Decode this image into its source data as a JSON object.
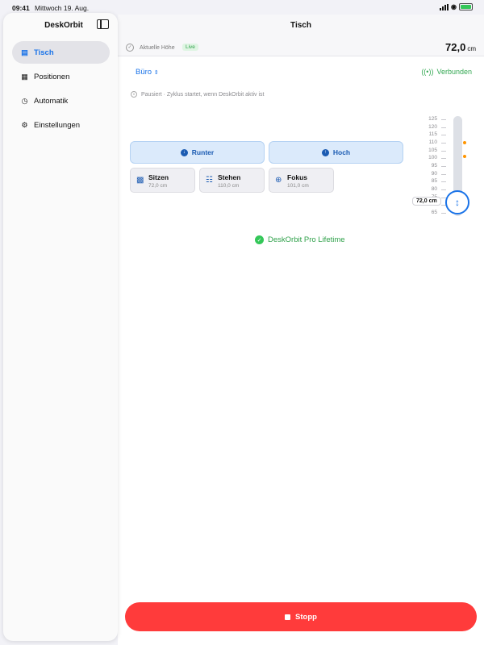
{
  "status": {
    "time": "09:41",
    "date": "Mittwoch 19. Aug."
  },
  "sidebar": {
    "title": "DeskOrbit",
    "items": [
      {
        "label": "Tisch",
        "icon": "desk-icon",
        "active": true
      },
      {
        "label": "Positionen",
        "icon": "grid-icon",
        "active": false
      },
      {
        "label": "Automatik",
        "icon": "clock-icon",
        "active": false
      },
      {
        "label": "Einstellungen",
        "icon": "gear-icon",
        "active": false
      }
    ]
  },
  "header": {
    "title": "Tisch",
    "height_label": "Aktuelle Höhe",
    "live_badge": "Live",
    "height_value": "72,0",
    "height_unit": "cm"
  },
  "room": {
    "selected": "Büro"
  },
  "connection": {
    "status": "Verbunden"
  },
  "cycle_status": "Pausiert · Zyklus startet, wenn DeskOrbit aktiv ist",
  "controls": {
    "down_label": "Runter",
    "up_label": "Hoch"
  },
  "presets": [
    {
      "name": "Sitzen",
      "value": "72,0 cm",
      "icon": "chair-icon"
    },
    {
      "name": "Stehen",
      "value": "110,0 cm",
      "icon": "person-standing-icon"
    },
    {
      "name": "Fokus",
      "value": "101,0 cm",
      "icon": "target-icon"
    }
  ],
  "scale": {
    "ticks": [
      "125",
      "120",
      "115",
      "110",
      "105",
      "100",
      "95",
      "90",
      "85",
      "80",
      "75",
      "70",
      "65"
    ],
    "min": 65,
    "max": 125,
    "current": 72,
    "current_label": "72,0 cm",
    "markers": [
      110,
      101
    ],
    "marker_color": "#ff9500"
  },
  "pro_label": "DeskOrbit Pro Lifetime",
  "stop_label": "Stopp",
  "colors": {
    "accent": "#1a73e8",
    "success": "#34c759",
    "stop": "#ff3b3b"
  }
}
